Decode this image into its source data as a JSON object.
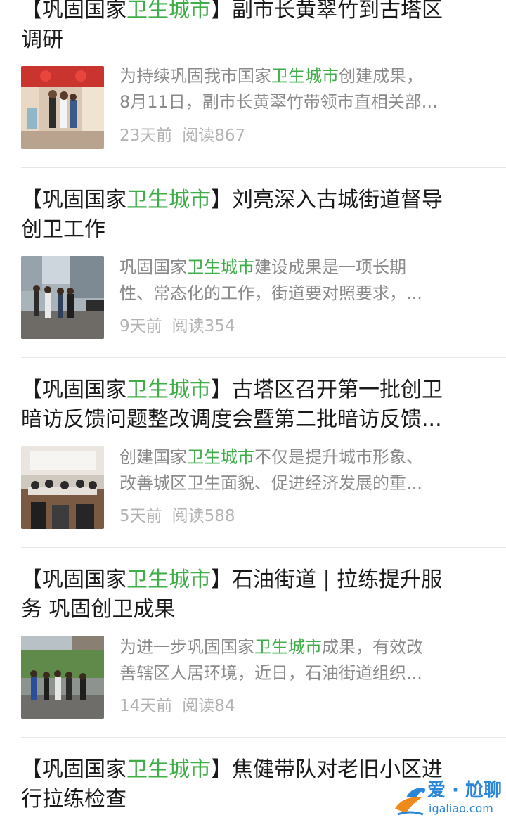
{
  "articles": [
    {
      "title_line1_pre": "【巩固国家",
      "title_line1_hl": "卫生城市",
      "title_line1_post": "】副市长黄翠竹到古塔区",
      "title_line2": "调研",
      "snippet_line1_pre": "为持续巩固我市国家",
      "snippet_line1_hl": "卫生城市",
      "snippet_line1_post": "创建成果，",
      "snippet_line2": "8月11日，副市长黄翠竹带领市直相关部...",
      "time": "23天前",
      "reads": "阅读867"
    },
    {
      "title_line1_pre": "【巩固国家",
      "title_line1_hl": "卫生城市",
      "title_line1_post": "】刘亮深入古城街道督导",
      "title_line2": "创卫工作",
      "snippet_line1_pre": "巩固国家",
      "snippet_line1_hl": "卫生城市",
      "snippet_line1_post": "建设成果是一项长期",
      "snippet_line2": "性、常态化的工作，街道要对照要求，...",
      "time": "9天前",
      "reads": "阅读354"
    },
    {
      "title_line1_pre": "【巩固国家",
      "title_line1_hl": "卫生城市",
      "title_line1_post": "】古塔区召开第一批创卫",
      "title_line2": "暗访反馈问题整改调度会暨第二批暗访反馈...",
      "snippet_line1_pre": "创建国家",
      "snippet_line1_hl": "卫生城市",
      "snippet_line1_post": "不仅是提升城市形象、",
      "snippet_line2": "改善城区卫生面貌、促进经济发展的重...",
      "time": "5天前",
      "reads": "阅读588"
    },
    {
      "title_line1_pre": "【巩固国家",
      "title_line1_hl": "卫生城市",
      "title_line1_post": "】石油街道 | 拉练提升服",
      "title_line2": "务 巩固创卫成果",
      "snippet_line1_pre": "为进一步巩固国家",
      "snippet_line1_hl": "卫生城市",
      "snippet_line1_post": "成果，有效改",
      "snippet_line2": "善辖区人居环境，近日，石油街道组织...",
      "time": "14天前",
      "reads": "阅读84"
    },
    {
      "title_line1_pre": "【巩固国家",
      "title_line1_hl": "卫生城市",
      "title_line1_post": "】焦健带队对老旧小区进",
      "title_line2": "行拉练检查"
    }
  ],
  "first_title_partial": {
    "pre": "【巩固国家",
    "hl": "卫生城市",
    "post": "】副市长黄翠竹到古塔区"
  },
  "watermark": {
    "brand": "爱 · 尬聊",
    "url": "igaliao.com"
  },
  "colors": {
    "highlight": "#3fae49",
    "title": "#1a1a1a",
    "snippet": "#8a8a8a",
    "meta": "#b3b3b3",
    "divider": "#e6e6e6"
  }
}
